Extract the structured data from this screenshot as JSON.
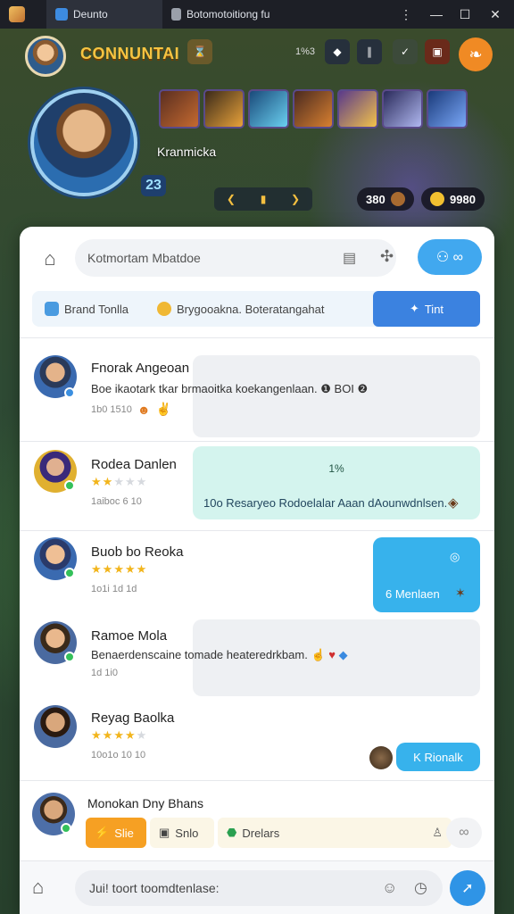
{
  "window": {
    "tabs": [
      {
        "label": "Deunto",
        "active": true
      },
      {
        "label": "Botomotoitiong fu",
        "active": false
      }
    ],
    "controls": {
      "more": "⋮",
      "minimize": "—",
      "maximize": "☐",
      "close": "✕"
    }
  },
  "hud": {
    "title": "CONNUNTAI",
    "mini_label": "1%3",
    "player_name": "Kranmicka",
    "level": "23",
    "resource_left": "380",
    "resource_right": "9980",
    "accent_color": "#f08a24"
  },
  "header": {
    "search_placeholder": "Kotmortam Mbatdoe",
    "pill_label": "⚇ ∞"
  },
  "filters": {
    "item1": "Brand Tonlla",
    "item2": "Brygooakna. Boteratangahat",
    "active_tab": "Tint"
  },
  "messages": [
    {
      "name": "Fnorak Angeoan",
      "line2": "Boe ikaotark tkar brmaoitka koekangenlaan. ❶ BOI ❷",
      "meta": "1b0   1510",
      "stars": 0
    },
    {
      "name": "Rodea Danlen",
      "line2": "",
      "meta": "1aiboc  6  10",
      "stars": 2,
      "bubble_title": "1%",
      "bubble_text": "10o Resaryeo Rodoelalar Aaan dAounwdnlsen."
    },
    {
      "name": "Buob bo Reoka",
      "meta": "1o1i   1d   1d",
      "stars": 5,
      "bubble_text": "6  Menlaen"
    },
    {
      "name": "Ramoe Mola",
      "line2": "Benaerdenscaine tomade heateredrkbam.",
      "meta": "1d 1i0"
    },
    {
      "name": "Reyag Baolka",
      "meta": "10o1o  10  10",
      "stars": 4,
      "bubble_text": "K Rionalk"
    }
  ],
  "quick_bar": {
    "title": "Monokan Dny Bhans",
    "chip1": "Slie",
    "chip2": "Snlo",
    "chip3": "Drelars"
  },
  "compose": {
    "placeholder": "Jui! toort toomdtenlase:"
  }
}
